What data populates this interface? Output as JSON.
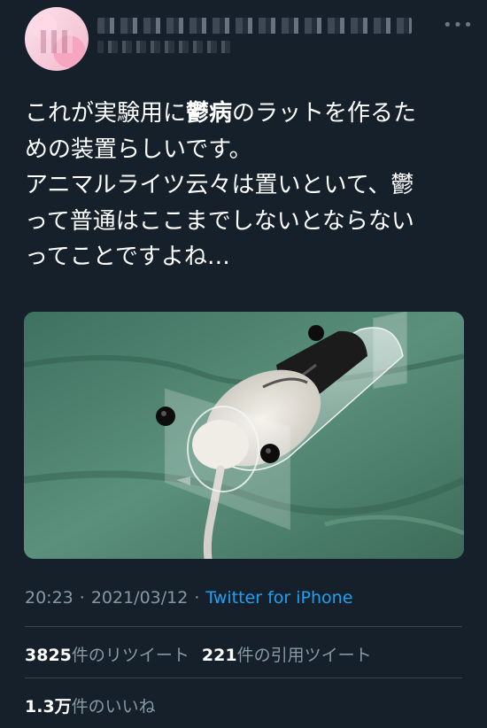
{
  "tweet": {
    "line1_a": "これが実験用に",
    "line1_bold": "鬱病",
    "line1_b": "のラットを作るた",
    "line2": "めの装置らしいです。",
    "line3": "アニマルライツ云々は置いといて、鬱",
    "line4": "って普通はここまでしないとならない",
    "line5": "ってことですよね…"
  },
  "meta": {
    "time": "20:23",
    "separator1": "·",
    "date": "2021/03/12",
    "separator2": "·",
    "source": "Twitter for iPhone"
  },
  "stats": {
    "retweets_count": "3825",
    "retweets_label": "件のリツイート",
    "quotes_count": "221",
    "quotes_label": "件の引用ツイート",
    "likes_count": "1.3万",
    "likes_label": "件のいいね"
  },
  "icons": {
    "more": "more-horizontal-icon"
  }
}
